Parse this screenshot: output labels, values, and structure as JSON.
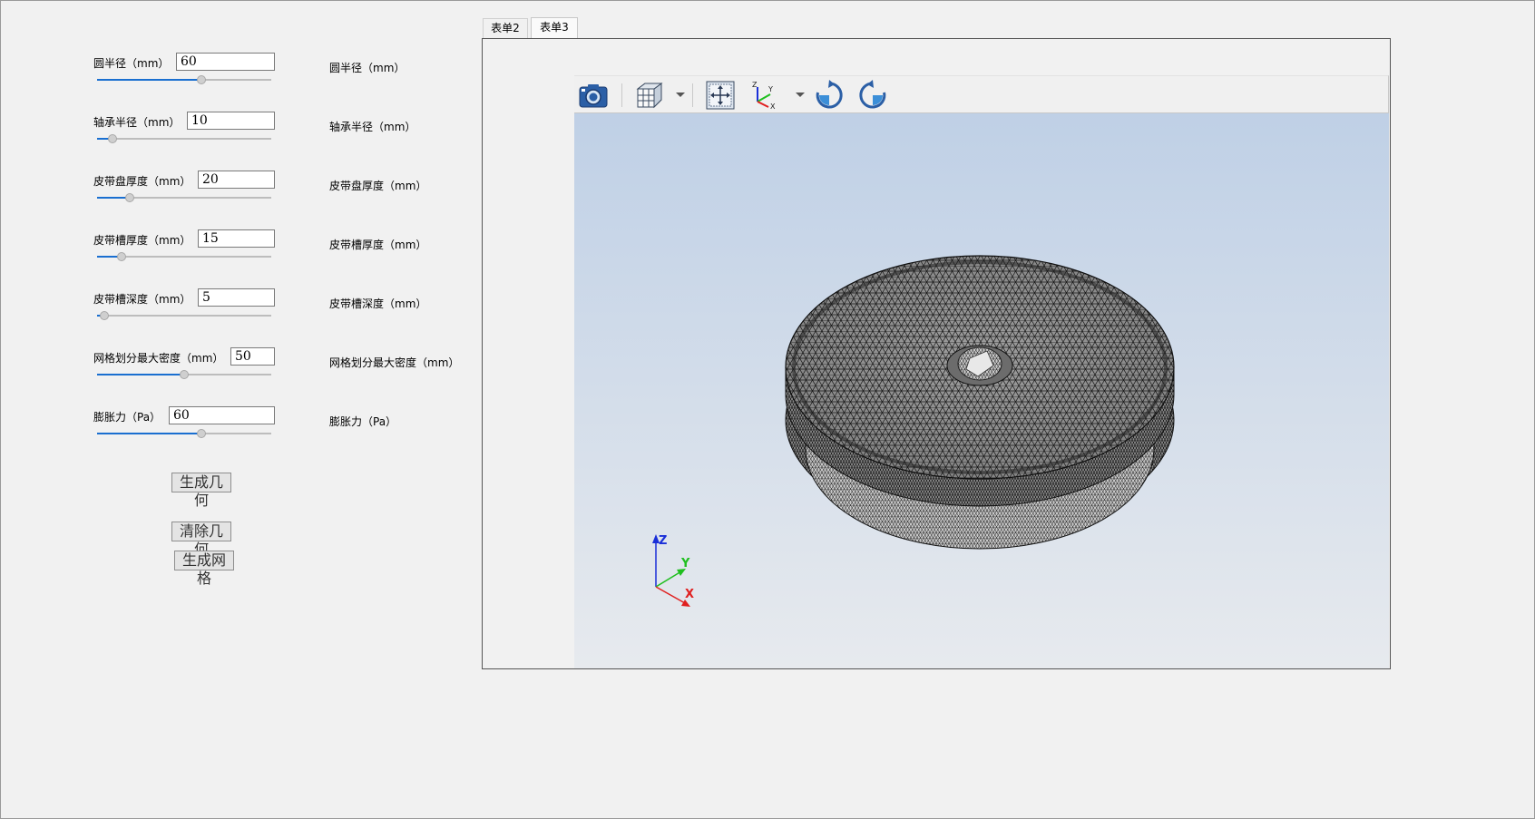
{
  "params": [
    {
      "label": "圆半径（mm）",
      "value": "60",
      "slider_fraction": 0.6,
      "right_label": "圆半径（mm）"
    },
    {
      "label": "轴承半径（mm）",
      "value": "10",
      "slider_fraction": 0.09,
      "right_label": "轴承半径（mm）"
    },
    {
      "label": "皮带盘厚度（mm）",
      "value": "20",
      "slider_fraction": 0.19,
      "right_label": "皮带盘厚度（mm）"
    },
    {
      "label": "皮带槽厚度（mm）",
      "value": "15",
      "slider_fraction": 0.14,
      "right_label": "皮带槽厚度（mm）"
    },
    {
      "label": "皮带槽深度（mm）",
      "value": "5",
      "slider_fraction": 0.04,
      "right_label": "皮带槽深度（mm）"
    },
    {
      "label": "网格划分最大密度（mm）",
      "value": "50",
      "slider_fraction": 0.5,
      "right_label": "网格划分最大密度（mm）"
    },
    {
      "label": "膨胀力（Pa）",
      "value": "60",
      "slider_fraction": 0.6,
      "right_label": "膨胀力（Pa）"
    }
  ],
  "buttons": {
    "generate_geometry": "生成几何",
    "clear_geometry": "清除几何",
    "generate_mesh": "生成网格"
  },
  "tabs": [
    {
      "label": "表单2",
      "active": false
    },
    {
      "label": "表单3",
      "active": true
    }
  ],
  "toolbar": {
    "icons": [
      "camera-icon",
      "view-cube-icon",
      "zoom-extents-icon",
      "axes-orientation-icon",
      "rotate-cw-icon",
      "rotate-ccw-icon"
    ]
  },
  "triad": {
    "x": "X",
    "y": "Y",
    "z": "Z"
  },
  "axes_icon_labels": {
    "z": "Z",
    "y": "Y",
    "x": "X"
  },
  "colors": {
    "accent": "#1a6fd0",
    "viewport_top": "#bfd0e6",
    "viewport_bottom": "#e7eaee",
    "mesh_fill": "#9b9b9b",
    "axis_x": "#e02020",
    "axis_y": "#1fbf1f",
    "axis_z": "#1a2fd8"
  }
}
